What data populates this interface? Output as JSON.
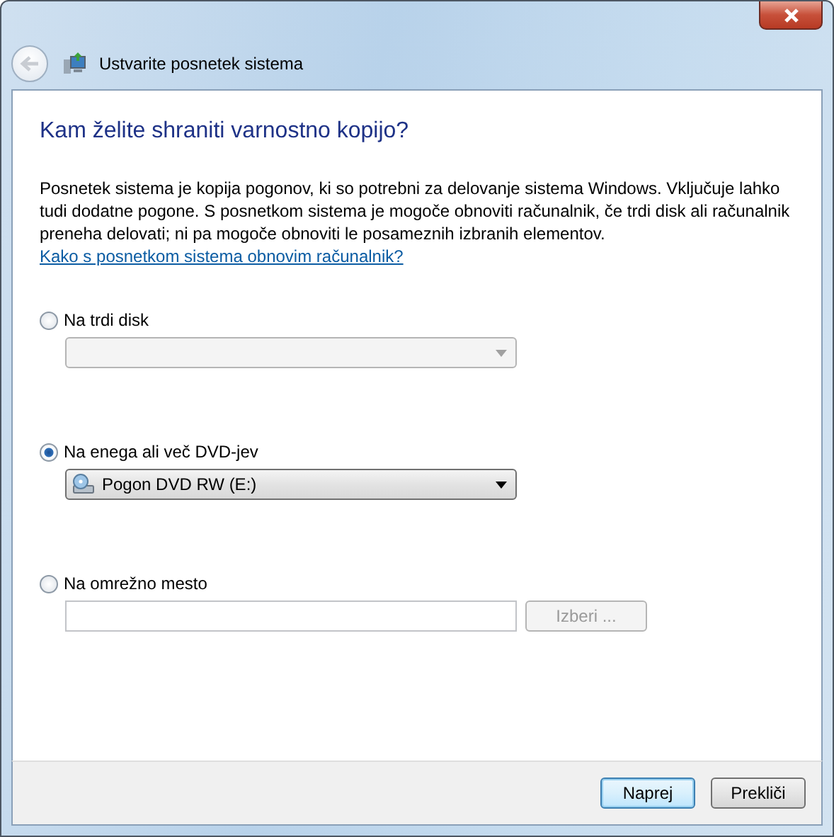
{
  "window": {
    "title": "Ustvarite posnetek sistema"
  },
  "heading": "Kam želite shraniti varnostno kopijo?",
  "description": "Posnetek sistema je kopija pogonov, ki so potrebni za delovanje sistema Windows. Vključuje lahko tudi dodatne pogone. S posnetkom sistema je mogoče obnoviti računalnik, če trdi disk ali računalnik preneha delovati; ni pa mogoče obnoviti le posameznih izbranih elementov.",
  "help_link": "Kako s posnetkom sistema obnovim računalnik?",
  "options": [
    {
      "label": "Na trdi disk",
      "selected": false,
      "control": {
        "kind": "dropdown",
        "disabled": true
      }
    },
    {
      "label": "Na enega ali več DVD-jev",
      "selected": true,
      "control": {
        "kind": "dropdown",
        "disabled": false,
        "value": "Pogon DVD RW (E:)"
      }
    },
    {
      "label": "Na omrežno mesto",
      "selected": false,
      "control": {
        "kind": "path",
        "disabled": true,
        "button": "Izberi ..."
      }
    }
  ],
  "buttons": [
    {
      "label": "Naprej",
      "default": true
    },
    {
      "label": "Prekliči",
      "default": false
    }
  ]
}
